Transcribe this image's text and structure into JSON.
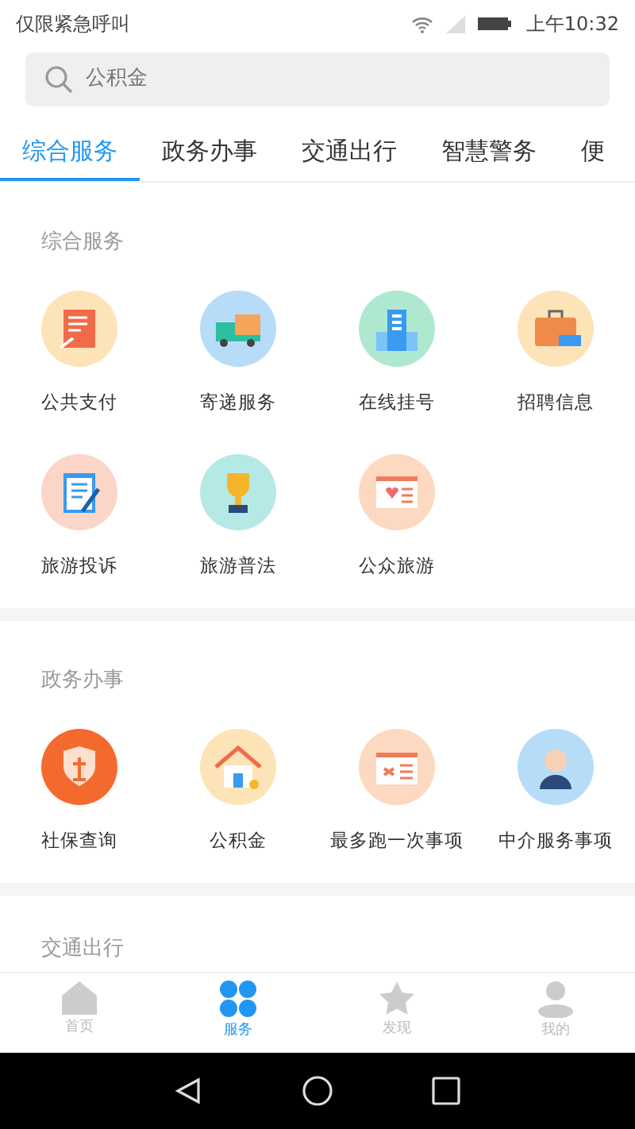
{
  "status_bar": {
    "carrier": "仅限紧急呼叫",
    "time": "上午10:32"
  },
  "search": {
    "placeholder": "公积金"
  },
  "tabs": [
    {
      "label": "综合服务",
      "selected": true
    },
    {
      "label": "政务办事",
      "selected": false
    },
    {
      "label": "交通出行",
      "selected": false
    },
    {
      "label": "智慧警务",
      "selected": false
    },
    {
      "label": "便",
      "selected": false
    }
  ],
  "sections": [
    {
      "title": "综合服务",
      "items": [
        {
          "label": "公共支付"
        },
        {
          "label": "寄递服务"
        },
        {
          "label": "在线挂号"
        },
        {
          "label": "招聘信息"
        },
        {
          "label": "旅游投诉"
        },
        {
          "label": "旅游普法"
        },
        {
          "label": "公众旅游"
        }
      ]
    },
    {
      "title": "政务办事",
      "items": [
        {
          "label": "社保查询"
        },
        {
          "label": "公积金"
        },
        {
          "label": "最多跑一次事项"
        },
        {
          "label": "中介服务事项"
        }
      ]
    },
    {
      "title": "交通出行"
    }
  ],
  "bottom_nav": [
    {
      "label": "首页",
      "selected": false
    },
    {
      "label": "服务",
      "selected": true
    },
    {
      "label": "发现",
      "selected": false
    },
    {
      "label": "我的",
      "selected": false
    }
  ]
}
